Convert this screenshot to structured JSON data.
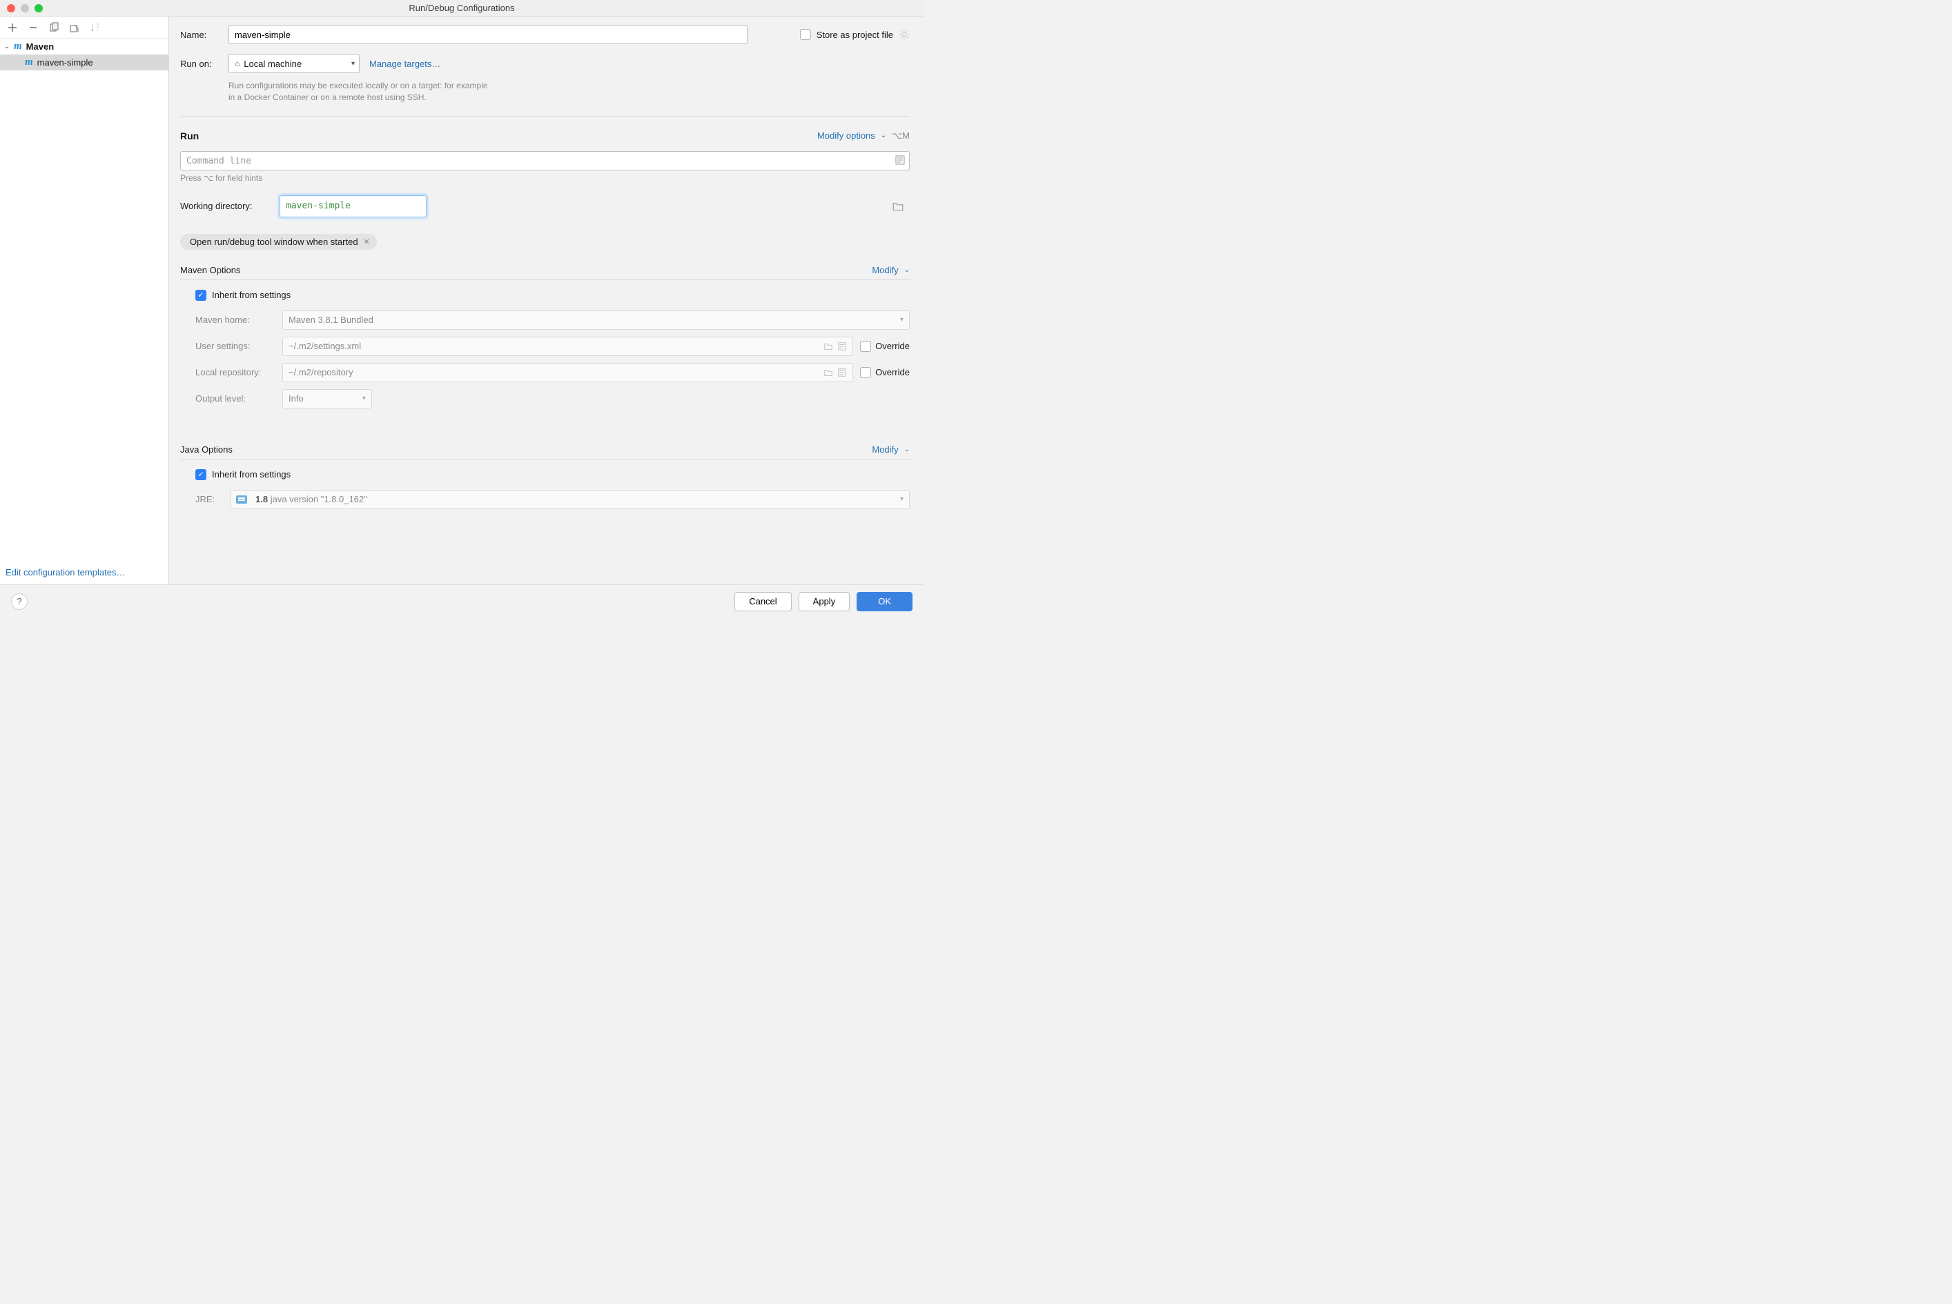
{
  "window": {
    "title": "Run/Debug Configurations"
  },
  "sidebar": {
    "root": "Maven",
    "item": "maven-simple",
    "edit_templates": "Edit configuration templates…"
  },
  "form": {
    "name_label": "Name:",
    "name_value": "maven-simple",
    "store_label": "Store as project file",
    "runon_label": "Run on:",
    "runon_value": "Local machine",
    "manage_targets": "Manage targets…",
    "runon_hint1": "Run configurations may be executed locally or on a target: for example",
    "runon_hint2": "in a Docker Container or on a remote host using SSH."
  },
  "run_section": {
    "title": "Run",
    "modify": "Modify options",
    "shortcut": "⌥M",
    "cmd_placeholder": "Command line",
    "press_hint": "Press ⌥ for field hints",
    "wd_label": "Working directory:",
    "wd_value": "maven-simple",
    "tag": "Open run/debug tool window when started"
  },
  "maven_options": {
    "title": "Maven Options",
    "modify": "Modify",
    "inherit": "Inherit from settings",
    "home_label": "Maven home:",
    "home_value": "Maven 3.8.1 Bundled",
    "user_label": "User settings:",
    "user_value": "~/.m2/settings.xml",
    "repo_label": "Local repository:",
    "repo_value": "~/.m2/repository",
    "output_label": "Output level:",
    "output_value": "Info",
    "override": "Override"
  },
  "java_options": {
    "title": "Java Options",
    "modify": "Modify",
    "inherit": "Inherit from settings",
    "jre_label": "JRE:",
    "jre_bold": "1.8",
    "jre_rest": "java version \"1.8.0_162\""
  },
  "footer": {
    "cancel": "Cancel",
    "apply": "Apply",
    "ok": "OK"
  }
}
